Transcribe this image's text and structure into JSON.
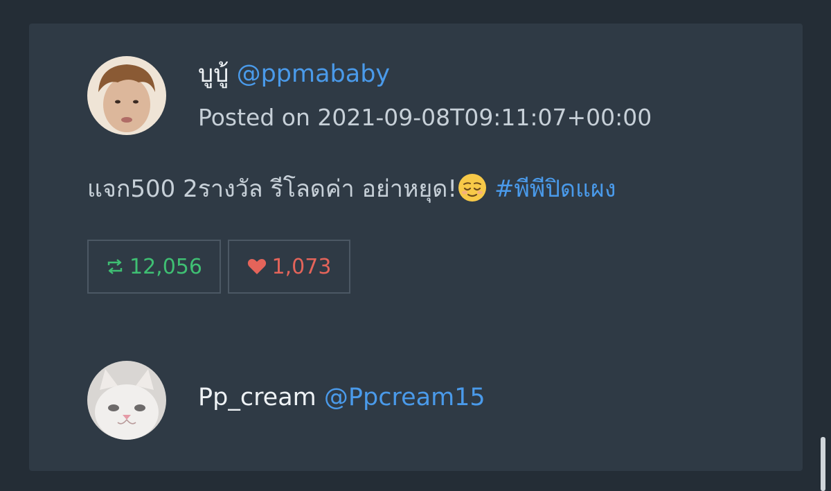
{
  "posts": [
    {
      "display_name": "บูบู้",
      "handle": "@ppmababy",
      "posted": "Posted on 2021-09-08T09:11:07+00:00",
      "text": "แจก500 2รางวัล รีโลดค่า อย่าหยุด!",
      "emoji": "relieved-face-emoji",
      "hashtag": "#พีพีปิดแผง",
      "retweets": "12,056",
      "likes": "1,073"
    },
    {
      "display_name": "Pp_cream",
      "handle": "@Ppcream15"
    }
  ],
  "icons": {
    "retweet": "retweet-icon",
    "like": "heart-icon"
  },
  "colors": {
    "background": "#242d36",
    "card": "#2f3a45",
    "link": "#4a9aea",
    "retweet": "#3fbf73",
    "like": "#e4645a"
  }
}
